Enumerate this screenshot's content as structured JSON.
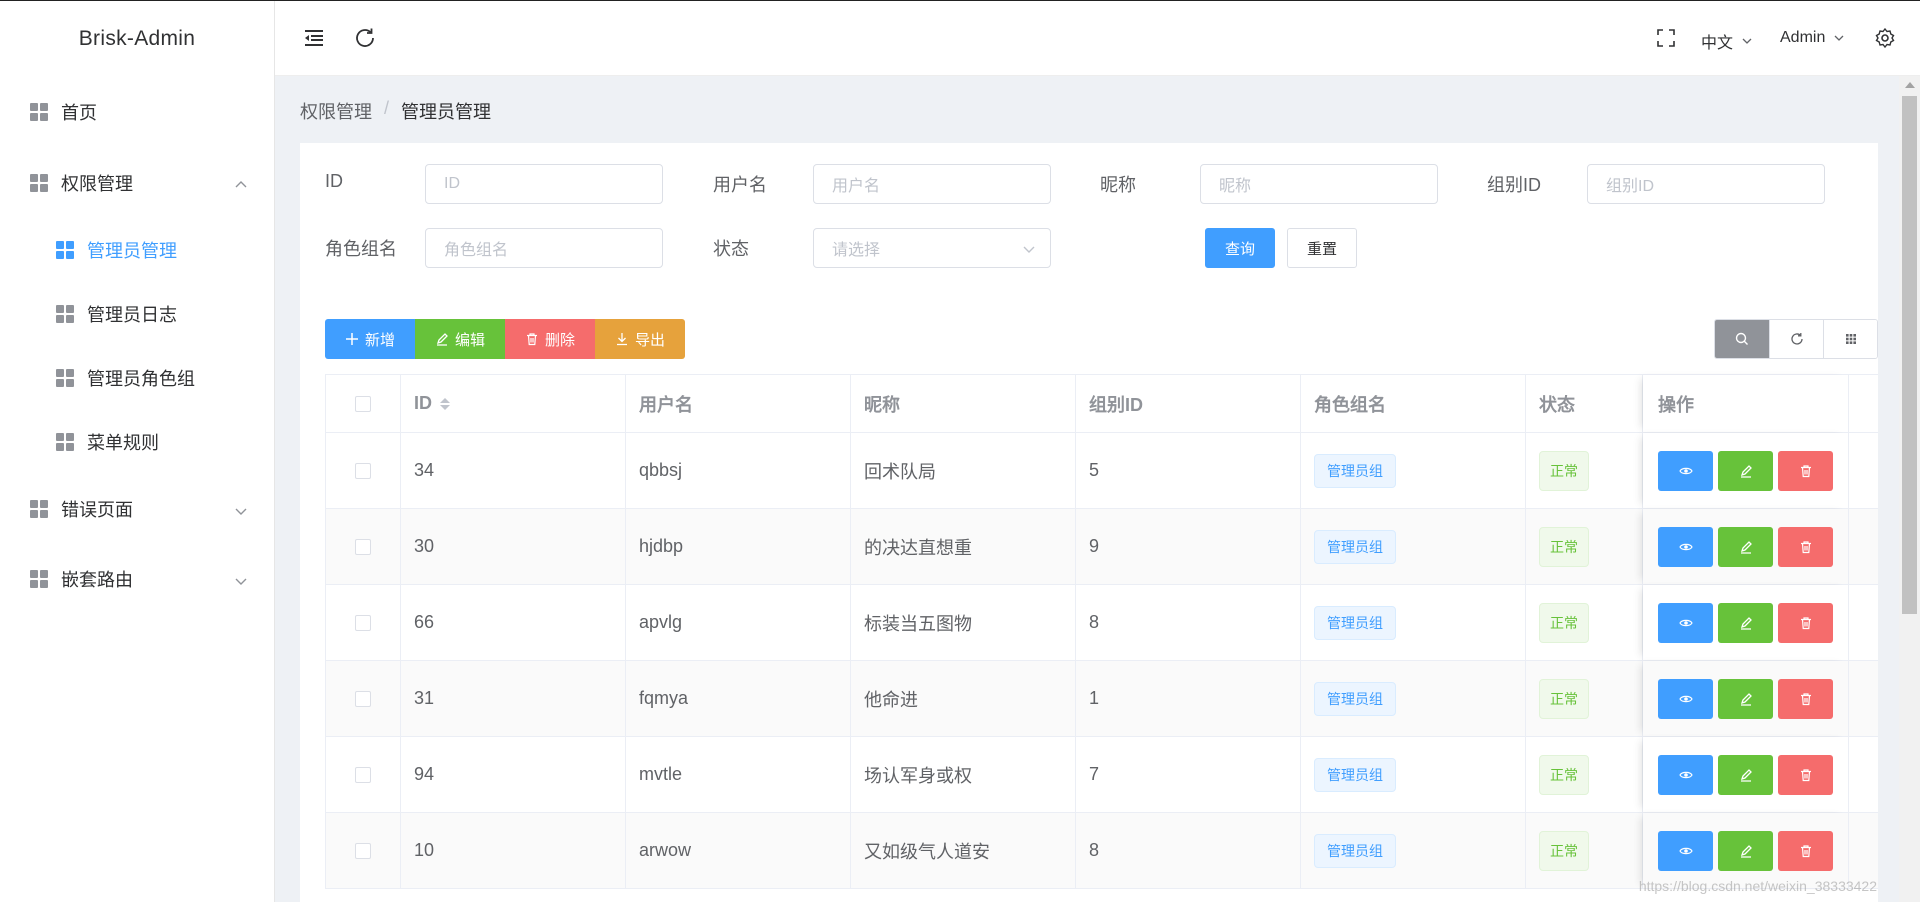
{
  "app": {
    "title": "Brisk-Admin"
  },
  "sidebar": {
    "items": [
      {
        "label": "首页"
      },
      {
        "label": "权限管理"
      },
      {
        "label": "管理员管理"
      },
      {
        "label": "管理员日志"
      },
      {
        "label": "管理员角色组"
      },
      {
        "label": "菜单规则"
      },
      {
        "label": "错误页面"
      },
      {
        "label": "嵌套路由"
      }
    ]
  },
  "header": {
    "language": "中文",
    "user": "Admin"
  },
  "breadcrumb": {
    "parent": "权限管理",
    "separator": "/",
    "current": "管理员管理"
  },
  "filters": {
    "id_label": "ID",
    "id_placeholder": "ID",
    "username_label": "用户名",
    "username_placeholder": "用户名",
    "nickname_label": "昵称",
    "nickname_placeholder": "昵称",
    "groupid_label": "组别ID",
    "groupid_placeholder": "组别ID",
    "rolegroup_label": "角色组名",
    "rolegroup_placeholder": "角色组名",
    "status_label": "状态",
    "status_placeholder": "请选择",
    "query_button": "查询",
    "reset_button": "重置"
  },
  "toolbar": {
    "add": "新增",
    "edit": "编辑",
    "delete": "删除",
    "export": "导出"
  },
  "table": {
    "columns": [
      "ID",
      "用户名",
      "昵称",
      "组别ID",
      "角色组名",
      "状态",
      "操作"
    ],
    "rows": [
      {
        "id": "34",
        "username": "qbbsj",
        "nickname": "回术队局",
        "group_id": "5",
        "role": "管理员组",
        "status": "正常"
      },
      {
        "id": "30",
        "username": "hjdbp",
        "nickname": "的决达直想重",
        "group_id": "9",
        "role": "管理员组",
        "status": "正常"
      },
      {
        "id": "66",
        "username": "apvlg",
        "nickname": "标装当五图物",
        "group_id": "8",
        "role": "管理员组",
        "status": "正常"
      },
      {
        "id": "31",
        "username": "fqmya",
        "nickname": "他命进",
        "group_id": "1",
        "role": "管理员组",
        "status": "正常"
      },
      {
        "id": "94",
        "username": "mvtle",
        "nickname": "场认军身或权",
        "group_id": "7",
        "role": "管理员组",
        "status": "正常"
      },
      {
        "id": "10",
        "username": "arwow",
        "nickname": "又如级气人道安",
        "group_id": "8",
        "role": "管理员组",
        "status": "正常"
      }
    ]
  },
  "watermark": "https://blog.csdn.net/weixin_38333422",
  "colors": {
    "primary": "#409EFF",
    "success": "#67C23A",
    "danger": "#F56C6C",
    "warning": "#E6A23C"
  }
}
